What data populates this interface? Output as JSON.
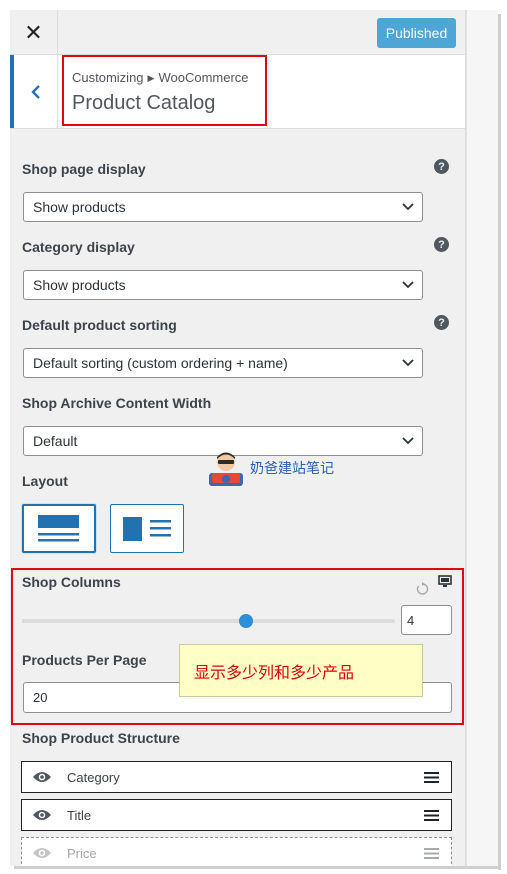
{
  "header": {
    "close_icon": "close-x-icon",
    "publish_label": "Published",
    "accent_color": "#2271b1"
  },
  "section": {
    "breadcrumb_root": "Customizing",
    "breadcrumb_parent": "WooCommerce",
    "title": "Product Catalog"
  },
  "controls": {
    "shop_page_display": {
      "label": "Shop page display",
      "value": "Show products"
    },
    "category_display": {
      "label": "Category display",
      "value": "Show products"
    },
    "default_sorting": {
      "label": "Default product sorting",
      "value": "Default sorting (custom ordering + name)"
    },
    "archive_width": {
      "label": "Shop Archive Content Width",
      "value": "Default"
    },
    "layout": {
      "label": "Layout",
      "options": [
        "full-width",
        "sidebar"
      ],
      "selected": "full-width"
    },
    "shop_columns": {
      "label": "Shop Columns",
      "value": "4",
      "slider_fraction": 0.6
    },
    "products_per_page": {
      "label": "Products Per Page",
      "value": "20"
    },
    "product_structure": {
      "label": "Shop Product Structure",
      "items": [
        {
          "name": "Category",
          "visible": true
        },
        {
          "name": "Title",
          "visible": true
        },
        {
          "name": "Price",
          "visible": false
        }
      ]
    }
  },
  "annotation": {
    "note_text": "显示多少列和多少产品",
    "note_color": "#d9000d",
    "highlight_color": "#e0070f"
  },
  "watermark": {
    "text": "奶爸建站笔记"
  }
}
